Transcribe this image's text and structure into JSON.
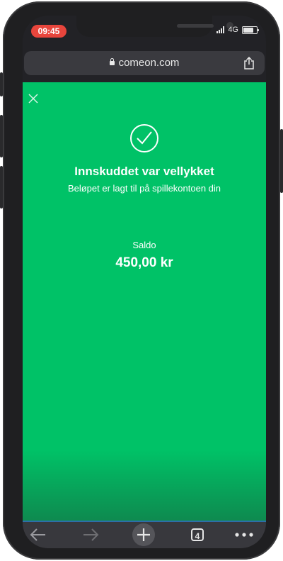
{
  "status_bar": {
    "time": "09:45",
    "network": "4G"
  },
  "browser": {
    "url": "comeon.com",
    "tab_count": "4"
  },
  "confirmation": {
    "title": "Innskuddet var vellykket",
    "subtitle": "Beløpet er lagt til på spillekontoen din",
    "balance_label": "Saldo",
    "balance_value": "450,00 kr"
  },
  "colors": {
    "success_green": "#00c267",
    "time_pill": "#e8453c",
    "toolbar_bg": "#38383d"
  },
  "icons": {
    "close": "close-icon",
    "success": "check-circle-icon",
    "share": "share-icon",
    "back": "back-arrow-icon",
    "forward": "forward-arrow-icon",
    "new_tab": "plus-icon",
    "tabs": "tabs-icon",
    "more": "more-icon"
  }
}
